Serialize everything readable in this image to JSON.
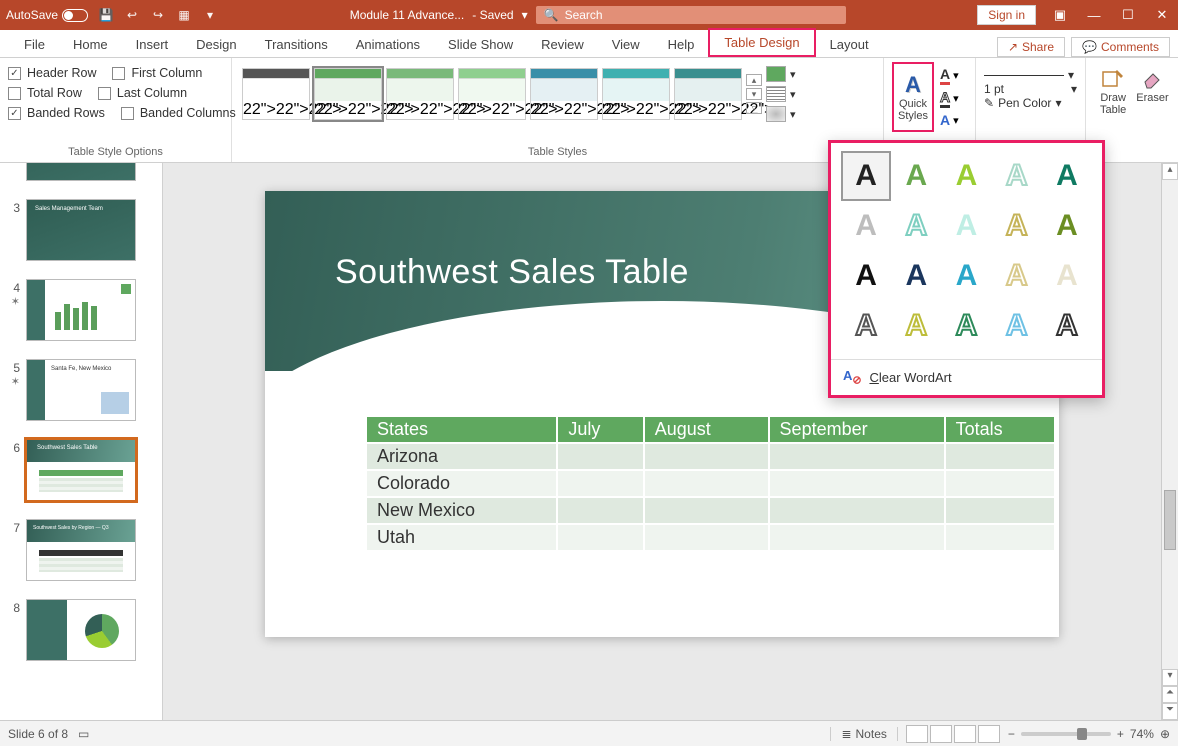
{
  "titlebar": {
    "autosave_label": "AutoSave",
    "autosave_state": "On",
    "doc_name": "Module 11 Advance...",
    "save_state": "- Saved",
    "search_placeholder": "Search",
    "signin": "Sign in"
  },
  "tabs": {
    "items": [
      "File",
      "Home",
      "Insert",
      "Design",
      "Transitions",
      "Animations",
      "Slide Show",
      "Review",
      "View",
      "Help",
      "Table Design",
      "Layout"
    ],
    "active": "Table Design",
    "share": "Share",
    "comments": "Comments"
  },
  "ribbon": {
    "group_table_style_options": {
      "title": "Table Style Options",
      "header_row": "Header Row",
      "first_column": "First Column",
      "total_row": "Total Row",
      "last_column": "Last Column",
      "banded_rows": "Banded Rows",
      "banded_columns": "Banded Columns"
    },
    "group_table_styles": {
      "title": "Table Styles"
    },
    "group_wordart": {
      "quick_styles": "Quick\nStyles"
    },
    "group_borders": {
      "weight": "1 pt",
      "pen_color": "Pen Color"
    },
    "group_draw": {
      "draw_table": "Draw\nTable",
      "eraser": "Eraser"
    }
  },
  "wordart": {
    "clear": "Clear WordArt",
    "styles": [
      {
        "color": "#222",
        "fill": "#222"
      },
      {
        "color": "#6aa84f",
        "fill": "#6aa84f"
      },
      {
        "color": "#9acd32",
        "fill": "#9acd32"
      },
      {
        "color": "#a8d8c8",
        "fill": "transparent"
      },
      {
        "color": "#0f7a62",
        "fill": "#0f7a62"
      },
      {
        "color": "#bdbdbd",
        "fill": "#bdbdbd"
      },
      {
        "color": "#7ecfc0",
        "fill": "transparent"
      },
      {
        "color": "#6fcfc0",
        "fill": "#bfeee4"
      },
      {
        "color": "#c5b358",
        "fill": "transparent"
      },
      {
        "color": "#6b8e23",
        "fill": "#6b8e23"
      },
      {
        "color": "#111",
        "fill": "#111"
      },
      {
        "color": "#1b365d",
        "fill": "#1b365d"
      },
      {
        "color": "#2aa7c9",
        "fill": "#2aa7c9"
      },
      {
        "color": "#d8c98a",
        "fill": "transparent"
      },
      {
        "color": "#e8e3cf",
        "fill": "#e8e3cf"
      },
      {
        "color": "#555",
        "fill": "transparent"
      },
      {
        "color": "#bdbd3a",
        "fill": "transparent"
      },
      {
        "color": "#2d8a5a",
        "fill": "transparent"
      },
      {
        "color": "#6ec1e4",
        "fill": "transparent"
      },
      {
        "color": "#333",
        "fill": "transparent"
      }
    ]
  },
  "thumbs": {
    "numbers": [
      "3",
      "4",
      "5",
      "6",
      "7",
      "8"
    ],
    "stars": {
      "4": true,
      "5": true
    }
  },
  "slide": {
    "title": "Southwest Sales Table",
    "headers": [
      "States",
      "July",
      "August",
      "September",
      "Totals"
    ],
    "rows": [
      [
        "Arizona",
        "",
        "",
        "",
        ""
      ],
      [
        "Colorado",
        "",
        "",
        "",
        ""
      ],
      [
        "New Mexico",
        "",
        "",
        "",
        ""
      ],
      [
        "Utah",
        "",
        "",
        "",
        ""
      ]
    ]
  },
  "status": {
    "slide_count": "Slide 6 of 8",
    "notes": "Notes",
    "zoom": "74%"
  },
  "table_style_colors": [
    "#555",
    "#5fa85f",
    "#7ab97a",
    "#8fcf8f",
    "#3a8fa8",
    "#3fb0b0",
    "#3a8f8f"
  ]
}
